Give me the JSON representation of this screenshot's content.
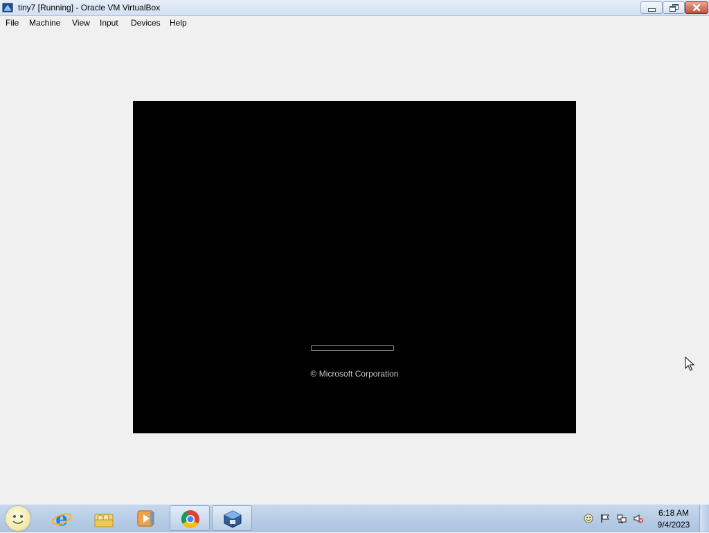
{
  "window": {
    "title": "tiny7 [Running] - Oracle VM VirtualBox",
    "controls": {
      "minimize": "minimize",
      "restore": "restore",
      "close": "close"
    }
  },
  "menu": {
    "items": [
      "File",
      "Machine",
      "View",
      "Input",
      "Devices",
      "Help"
    ]
  },
  "vm": {
    "copyright": "© Microsoft Corporation",
    "boot_progress_label": "boot-progress-bar"
  },
  "taskbar": {
    "apps": [
      {
        "name": "Internet Explorer",
        "icon": "internet-explorer-icon"
      },
      {
        "name": "Windows Explorer",
        "icon": "folder-icon"
      },
      {
        "name": "Windows Media Player",
        "icon": "media-player-icon"
      },
      {
        "name": "Google Chrome",
        "icon": "chrome-icon"
      },
      {
        "name": "Oracle VM VirtualBox",
        "icon": "virtualbox-icon"
      }
    ],
    "tray_icons": [
      "smiley-icon",
      "action-center-flag-icon",
      "network-icon",
      "volume-muted-icon"
    ],
    "clock": {
      "time": "6:18 AM",
      "date": "9/4/2023"
    }
  },
  "colors": {
    "vm_background": "#000000",
    "window_background": "#f0f0f0",
    "copyright_text": "#c8c8c8",
    "taskbar": "#b7cde6"
  }
}
